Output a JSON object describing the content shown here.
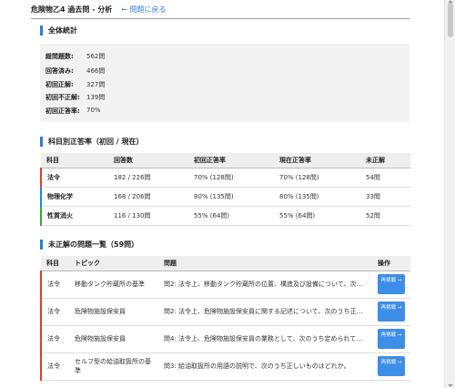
{
  "header": {
    "title": "危険物乙4 過去問 - 分析",
    "back_link": "← 問題に戻る"
  },
  "summary": {
    "section_title": "全体統計",
    "rows": [
      {
        "label": "総問題数:",
        "value": "562問"
      },
      {
        "label": "回答済み:",
        "value": "466問"
      },
      {
        "label": "初回正解:",
        "value": "327問"
      },
      {
        "label": "初回不正解:",
        "value": "139問"
      },
      {
        "label": "初回正答率:",
        "value": "70%"
      }
    ]
  },
  "subject_table": {
    "section_title": "科目別正答率（初回 / 現在）",
    "headers": [
      "科目",
      "回答数",
      "初回正答率",
      "現在正答率",
      "未正解"
    ],
    "rows": [
      {
        "subject": "法令",
        "answered": "182 / 226問",
        "first_rate": "70% (128問)",
        "current_rate": "70% (128問)",
        "unsolved": "54問",
        "color": "#e53935"
      },
      {
        "subject": "物理化学",
        "answered": "168 / 206問",
        "first_rate": "80% (135問)",
        "current_rate": "80% (135問)",
        "unsolved": "33問",
        "color": "#1e88e5"
      },
      {
        "subject": "性質消火",
        "answered": "116 / 130問",
        "first_rate": "55% (64問)",
        "current_rate": "55% (64問)",
        "unsolved": "52問",
        "color": "#43a047"
      }
    ]
  },
  "unsolved_table": {
    "section_title": "未正解の問題一覧（59問）",
    "headers": [
      "科目",
      "トピック",
      "問題",
      "操作"
    ],
    "button_label": "再挑戦 →",
    "rows": [
      {
        "subject": "法令",
        "topic": "移動タンク貯蔵所の基準",
        "question": "問2: 法令上、移動タンク貯蔵所の位置、構造及び設備について、次…"
      },
      {
        "subject": "法令",
        "topic": "危険物施設保安員",
        "question": "問2: 法令上、危険物施設保安員に関する記述について、次のうち正…"
      },
      {
        "subject": "法令",
        "topic": "危険物施設保安員",
        "question": "問4: 法令上、危険物施設保安員の業務として、次のうち定められて…"
      },
      {
        "subject": "法令",
        "topic": "セルフ型の給油取扱所の基準",
        "question": "問3: 給油取扱所の用語の説明で、次のうち正しいものはどれか。"
      }
    ],
    "accent_color": "#e53935"
  }
}
